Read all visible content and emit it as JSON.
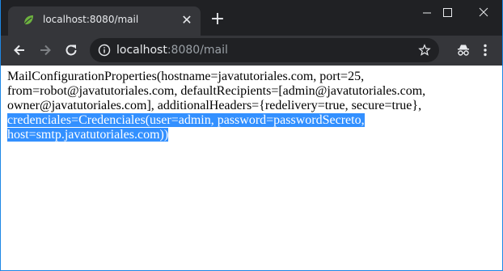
{
  "browser": {
    "tab_title": "localhost:8080/mail",
    "url_host": "localhost",
    "url_path": ":8080/mail",
    "close_tab_glyph": "✕",
    "new_tab_glyph": "+"
  },
  "page": {
    "lines": [
      "MailConfigurationProperties(hostname=javatutoriales.com, port=25,",
      "from=robot@javatutoriales.com, defaultRecipients=[admin@javatutoriales.com,",
      "owner@javatutoriales.com], additionalHeaders={redelivery=true, secure=true},"
    ],
    "selected_lines": [
      "credenciales=Credenciales(user=admin, password=passwordSecreto,",
      "host=smtp.javatutoriales.com))"
    ]
  },
  "colors": {
    "titlebar": "#202124",
    "tab": "#35363a",
    "selection": "#3390ff",
    "window_border": "#1e88e5",
    "favicon": "#6db33f"
  },
  "icons": [
    "leaf-favicon-icon",
    "close-icon",
    "plus-icon",
    "minimize-icon",
    "maximize-icon",
    "close-window-icon",
    "back-arrow-icon",
    "forward-arrow-icon",
    "reload-icon",
    "info-icon",
    "star-icon",
    "incognito-icon",
    "kebab-menu-icon"
  ]
}
